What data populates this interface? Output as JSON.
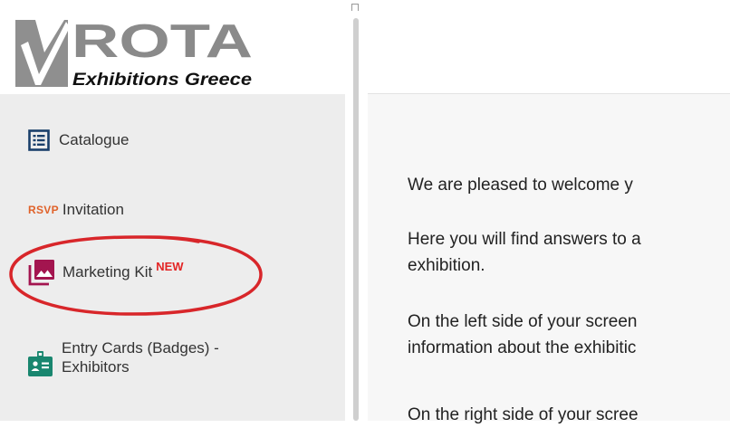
{
  "logo": {
    "brand": "ROTA",
    "tagline": "Exhibitions Greece"
  },
  "sidebar": {
    "items": [
      {
        "label": "Catalogue",
        "icon": "catalogue-list-icon"
      },
      {
        "label": "Invitation",
        "prefix": "RSVP",
        "icon": "rsvp-icon"
      },
      {
        "label": "Marketing Kit",
        "badge": "NEW",
        "icon": "image-gallery-icon"
      },
      {
        "label_line1": "Entry Cards (Badges) -",
        "label_line2": "Exhibitors",
        "icon": "badge-id-icon"
      }
    ]
  },
  "main": {
    "paragraphs": [
      "We are pleased to welcome y",
      "Here you will find answers to a",
      "exhibition.",
      "On the left side of your screen",
      "information about the exhibitic",
      "On the right side of your scree"
    ]
  },
  "colors": {
    "sidebar_bg": "#ededed",
    "logo_gray": "#8a8a8a",
    "catalogue_icon": "#1a3f6b",
    "rsvp": "#e0622a",
    "marketing_icon": "#a3154f",
    "new_badge": "#e32424",
    "entry_icon": "#19866f",
    "highlight": "#d8262a"
  }
}
